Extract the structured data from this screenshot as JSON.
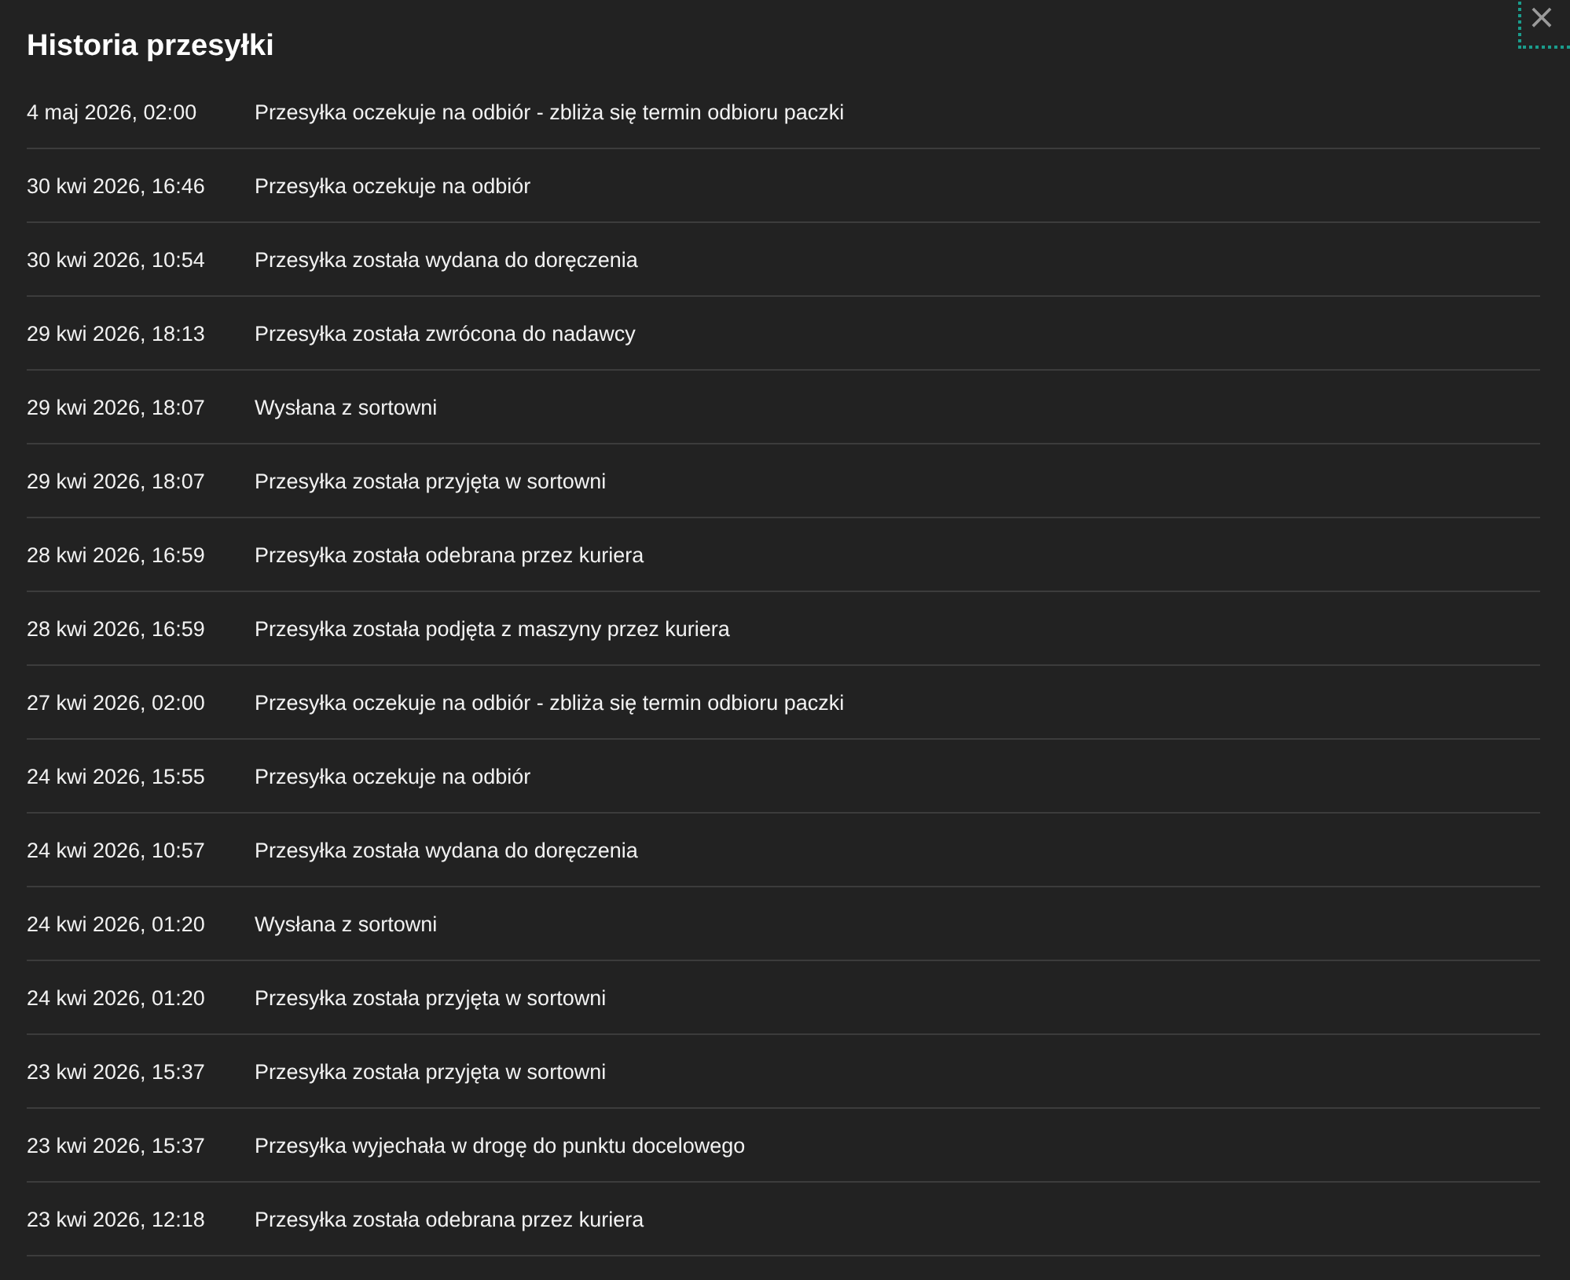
{
  "title": "Historia przesyłki",
  "close": {
    "label": "×",
    "focused": true
  },
  "events": [
    {
      "date": "4 maj 2026, 02:00",
      "text": "Przesyłka oczekuje na odbiór - zbliża się termin odbioru paczki"
    },
    {
      "date": "30 kwi 2026, 16:46",
      "text": "Przesyłka oczekuje na odbiór"
    },
    {
      "date": "30 kwi 2026, 10:54",
      "text": "Przesyłka została wydana do doręczenia"
    },
    {
      "date": "29 kwi 2026, 18:13",
      "text": "Przesyłka została zwrócona do nadawcy"
    },
    {
      "date": "29 kwi 2026, 18:07",
      "text": "Wysłana z sortowni"
    },
    {
      "date": "29 kwi 2026, 18:07",
      "text": "Przesyłka została przyjęta w sortowni"
    },
    {
      "date": "28 kwi 2026, 16:59",
      "text": "Przesyłka została odebrana przez kuriera"
    },
    {
      "date": "28 kwi 2026, 16:59",
      "text": "Przesyłka została podjęta z maszyny przez kuriera"
    },
    {
      "date": "27 kwi 2026, 02:00",
      "text": "Przesyłka oczekuje na odbiór - zbliża się termin odbioru paczki"
    },
    {
      "date": "24 kwi 2026, 15:55",
      "text": "Przesyłka oczekuje na odbiór"
    },
    {
      "date": "24 kwi 2026, 10:57",
      "text": "Przesyłka została wydana do doręczenia"
    },
    {
      "date": "24 kwi 2026, 01:20",
      "text": "Wysłana z sortowni"
    },
    {
      "date": "24 kwi 2026, 01:20",
      "text": "Przesyłka została przyjęta w sortowni"
    },
    {
      "date": "23 kwi 2026, 15:37",
      "text": "Przesyłka została przyjęta w sortowni"
    },
    {
      "date": "23 kwi 2026, 15:37",
      "text": "Przesyłka wyjechała w drogę do punktu docelowego"
    },
    {
      "date": "23 kwi 2026, 12:18",
      "text": "Przesyłka została odebrana przez kuriera"
    }
  ]
}
